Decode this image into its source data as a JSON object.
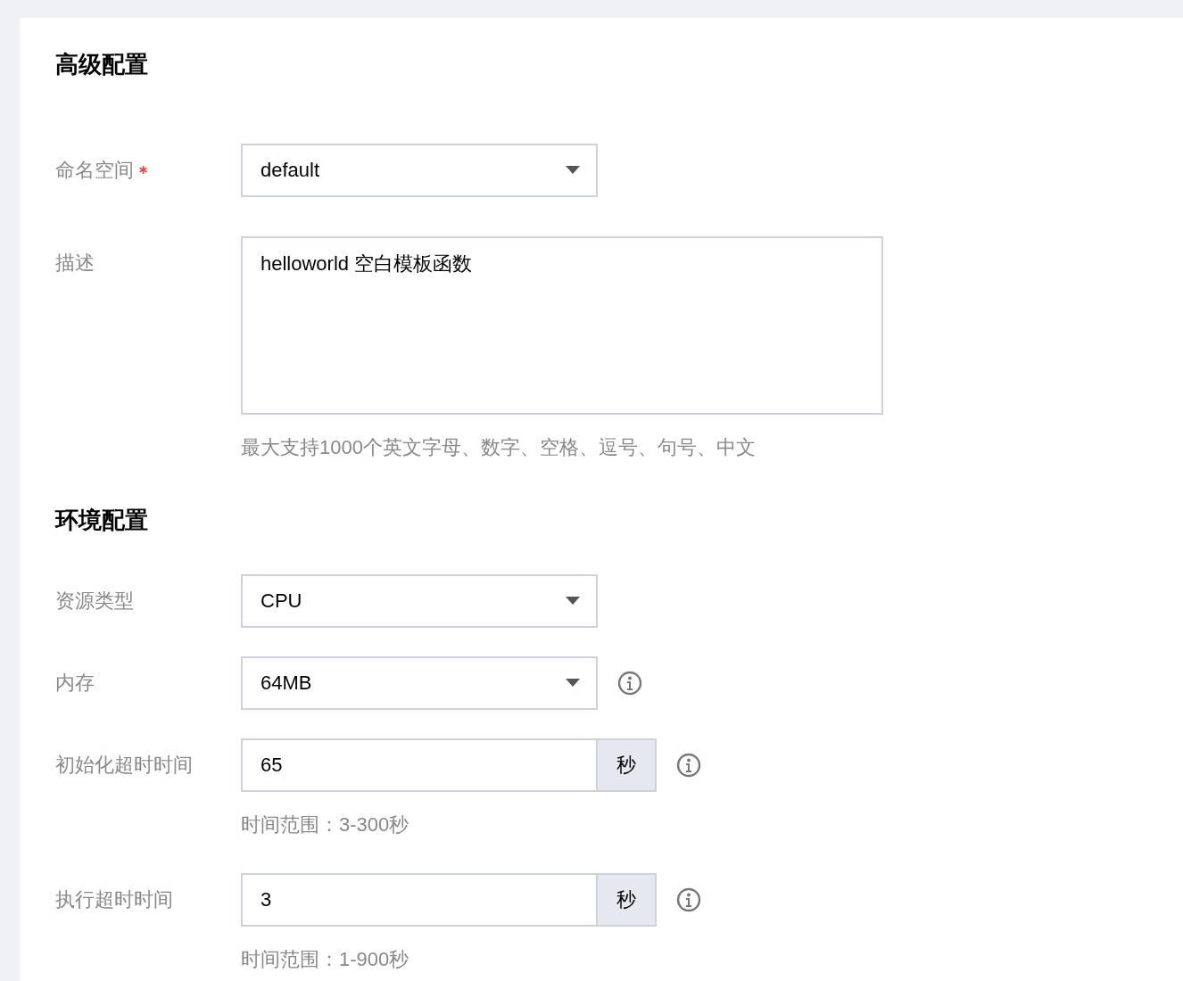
{
  "sections": [
    {
      "title": "高级配置",
      "fields": [
        {
          "kind": "select",
          "label": "命名空间",
          "required": true,
          "info": false,
          "value": "default"
        },
        {
          "kind": "textarea",
          "label": "描述",
          "required": false,
          "info": false,
          "value": "helloworld 空白模板函数",
          "hint": "最大支持1000个英文字母、数字、空格、逗号、句号、中文"
        }
      ]
    },
    {
      "title": "环境配置",
      "fields": [
        {
          "kind": "select",
          "label": "资源类型",
          "required": false,
          "info": false,
          "value": "CPU"
        },
        {
          "kind": "select",
          "label": "内存",
          "required": false,
          "info": true,
          "value": "64MB"
        },
        {
          "kind": "unit",
          "label": "初始化超时时间",
          "required": false,
          "info": true,
          "value": "65",
          "unit": "秒",
          "hint": "时间范围：3-300秒"
        },
        {
          "kind": "unit",
          "label": "执行超时时间",
          "required": false,
          "info": true,
          "value": "3",
          "unit": "秒",
          "hint": "时间范围：1-900秒"
        }
      ]
    }
  ]
}
